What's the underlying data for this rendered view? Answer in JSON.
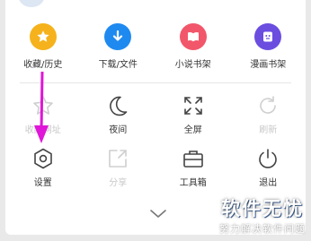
{
  "colors": {
    "favorites": "#f5b21c",
    "downloads": "#1e8af0",
    "novel": "#f2566a",
    "comic": "#6b4de0",
    "arrow": "#e016d8"
  },
  "top_row": [
    {
      "label": "收藏/历史",
      "icon": "star-icon"
    },
    {
      "label": "下载/文件",
      "icon": "download-icon"
    },
    {
      "label": "小说书架",
      "icon": "book-icon"
    },
    {
      "label": "漫画书架",
      "icon": "comic-icon"
    }
  ],
  "middle_row": [
    {
      "label": "收藏网址",
      "icon": "star-outline-icon",
      "enabled": false
    },
    {
      "label": "夜间",
      "icon": "moon-icon",
      "enabled": true
    },
    {
      "label": "全屏",
      "icon": "fullscreen-icon",
      "enabled": true
    },
    {
      "label": "刷新",
      "icon": "refresh-icon",
      "enabled": false
    }
  ],
  "bottom_row": [
    {
      "label": "设置",
      "icon": "gear-icon",
      "enabled": true
    },
    {
      "label": "分享",
      "icon": "share-icon",
      "enabled": false
    },
    {
      "label": "工具箱",
      "icon": "toolbox-icon",
      "enabled": true
    },
    {
      "label": "退出",
      "icon": "power-icon",
      "enabled": true
    }
  ],
  "watermark": {
    "title": "软件无忧",
    "subtitle": "努力解决软件问题"
  }
}
